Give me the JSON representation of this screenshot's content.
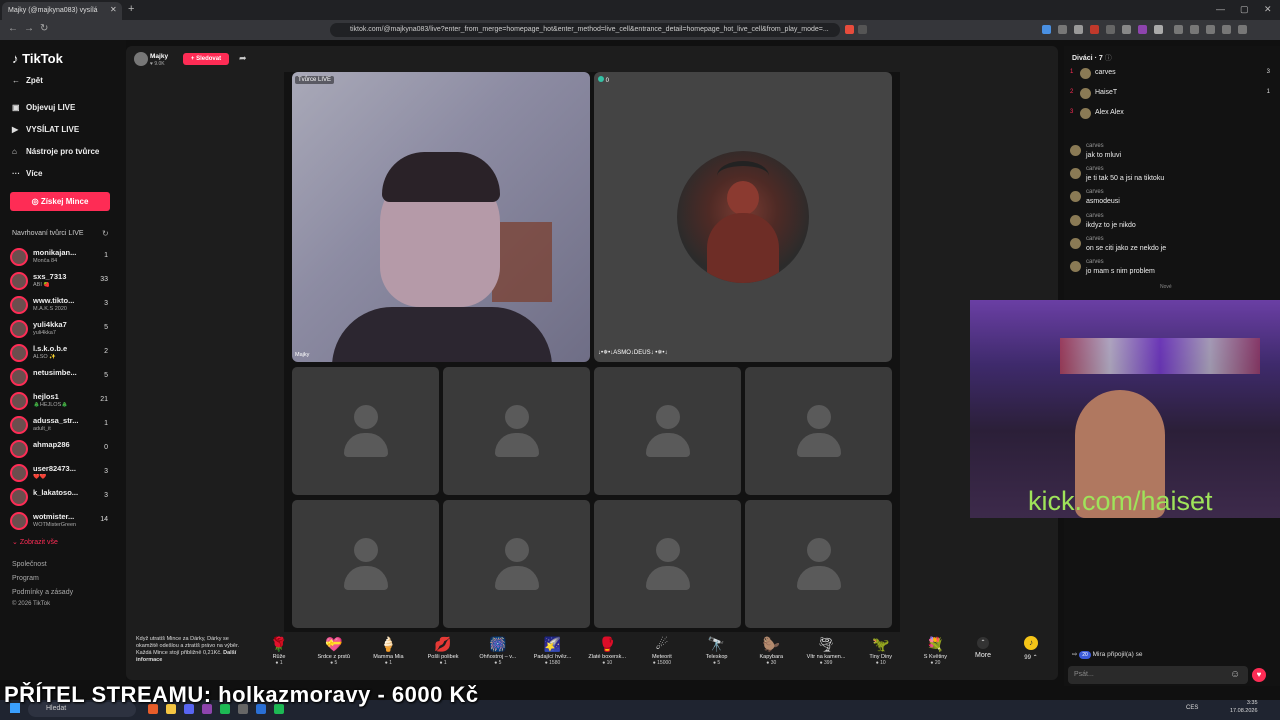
{
  "browser": {
    "tab_title": "Majky (@majkyna083) vysílá",
    "url": "tiktok.com/@majkyna083/live?enter_from_merge=homepage_hot&enter_method=live_cell&entrance_detail=homepage_hot_live_cell&from_play_mode=..."
  },
  "sidebar": {
    "logo": "TikTok",
    "back": "Zpět",
    "nav": [
      "Objevuj LIVE",
      "VYSÍLAT LIVE",
      "Nástroje pro tvůrce",
      "Více"
    ],
    "coins_button": "Získej Mince",
    "suggested_title": "Navrhovaní tvůrci LIVE",
    "creators": [
      {
        "name": "monikajan...",
        "sub": "Monča 84",
        "count": "1"
      },
      {
        "name": "sxs_7313",
        "sub": "ABI 🍓",
        "count": "33"
      },
      {
        "name": "www.tikto...",
        "sub": "M.A.K.S 2020",
        "count": "3"
      },
      {
        "name": "yuli4kka7",
        "sub": "yuli4kka7",
        "count": "5"
      },
      {
        "name": "l.s.k.o.b.e",
        "sub": "ALSO ✨",
        "count": "2"
      },
      {
        "name": "netusimbe...",
        "sub": "",
        "count": "5"
      },
      {
        "name": "hejlos1",
        "sub": "🎄HEJLOS🎄",
        "count": "21"
      },
      {
        "name": "adussa_str...",
        "sub": "adult_it",
        "count": "1"
      },
      {
        "name": "ahmap286",
        "sub": "",
        "count": "0"
      },
      {
        "name": "user82473...",
        "sub": "❤️❤️",
        "count": "3"
      },
      {
        "name": "k_lakatoso...",
        "sub": "",
        "count": "3"
      },
      {
        "name": "wotmister...",
        "sub": "WOTMisterGreen",
        "count": "14"
      }
    ],
    "show_all": "Zobrazit vše",
    "footer": [
      "Společnost",
      "Program",
      "Podmínky a zásady",
      "© 2026 TikTok"
    ]
  },
  "stream": {
    "host_name": "Majky",
    "host_likes": "9.0K",
    "follow_label": "+ Sledovat",
    "host_tag": "Tvůrce LIVE",
    "host_label": "Majky",
    "guest_count": "0",
    "guest_label": "↓•✵•↓ASMO↓DEUS↓ •✵•↓"
  },
  "gifts": {
    "info_text": "Když utratíš Mince za Dárky, Dárky se okamžitě odešlou a ztratíš právo na výběr. Každá Mince stojí přibližně 0,21Kč.",
    "info_link": "Další informace",
    "items": [
      {
        "icon": "🌹",
        "name": "Růže",
        "price": "1"
      },
      {
        "icon": "💝",
        "name": "Srdce z prstů",
        "price": "5"
      },
      {
        "icon": "🍦",
        "name": "Mamma Mia",
        "price": "1"
      },
      {
        "icon": "💋",
        "name": "Pošli polibek",
        "price": "1"
      },
      {
        "icon": "🎆",
        "name": "Ohňostroj – v...",
        "price": "5"
      },
      {
        "icon": "🌠",
        "name": "Padající hvěz...",
        "price": "1580"
      },
      {
        "icon": "🥊",
        "name": "Zlaté boxersk...",
        "price": "10"
      },
      {
        "icon": "☄",
        "name": "Meteorit",
        "price": "15000"
      },
      {
        "icon": "🔭",
        "name": "Teleskop",
        "price": "5"
      },
      {
        "icon": "🦫",
        "name": "Kapybara",
        "price": "30"
      },
      {
        "icon": "🌪",
        "name": "Vítr na kamen...",
        "price": "399"
      },
      {
        "icon": "🦖",
        "name": "Tiny Diny",
        "price": "10"
      },
      {
        "icon": "💐",
        "name": "S Květiny",
        "price": "20"
      }
    ],
    "more_label": "More",
    "coin_count": "99"
  },
  "viewers": {
    "title": "Diváci · 7",
    "list": [
      {
        "rank": "1",
        "name": "carves",
        "score": "3"
      },
      {
        "rank": "2",
        "name": "HaiseT",
        "score": "1"
      },
      {
        "rank": "3",
        "name": "Alex Alex",
        "score": ""
      }
    ]
  },
  "chat": {
    "messages": [
      {
        "user": "carves",
        "text": "jak to mluvi"
      },
      {
        "user": "carves",
        "text": "je ti tak 50 a jsi na tiktoku"
      },
      {
        "user": "carves",
        "text": "asmodeusi"
      },
      {
        "user": "carves",
        "text": "ikdyz to je nikdo"
      },
      {
        "user": "carves",
        "text": "on se citi jako ze nekdo je"
      },
      {
        "user": "carves",
        "text": "jo mam s nim problem"
      }
    ],
    "new_label": "Nové",
    "join_badge": "20",
    "join_user": "Mira",
    "join_text": "připojil(a) se",
    "input_placeholder": "Psát..."
  },
  "overlay": {
    "cam_text": "kick.com/haiset",
    "banner": "PŘÍTEL STREAMU: holkazmoravy - 6000 Kč"
  },
  "taskbar": {
    "search": "Hledat",
    "lang": "CES",
    "time": "3:35",
    "date": "17.08.2026"
  },
  "colors": {
    "accent": "#fe2c55",
    "cam_text": "#9fe35a"
  }
}
